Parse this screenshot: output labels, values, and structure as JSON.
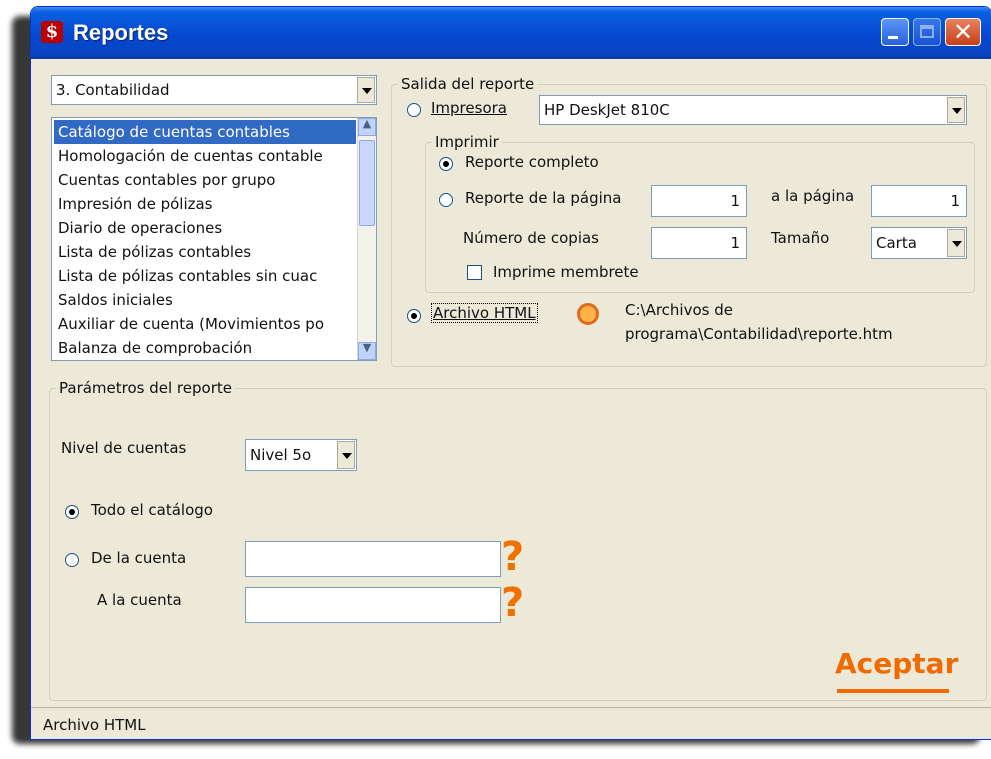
{
  "window": {
    "title": "Reportes",
    "app_icon": "S-logo-icon"
  },
  "module_select": {
    "value": "3. Contabilidad"
  },
  "report_list": {
    "items": [
      "Catálogo de cuentas contables",
      "Homologación de cuentas contable",
      "Cuentas contables por grupo",
      "Impresión de pólizas",
      "Diario de operaciones",
      "Lista de pólizas contables",
      "Lista de pólizas contables sin cuac",
      "Saldos iniciales",
      "Auxiliar de cuenta (Movimientos po",
      "Balanza de comprobación"
    ],
    "selected_index": 0
  },
  "output": {
    "legend": "Salida del reporte",
    "printer_radio": "Impresora",
    "printer_value": "HP DeskJet 810C",
    "print_group": {
      "legend": "Imprimir",
      "full_report": "Reporte completo",
      "page_report": "Reporte de la página",
      "from_page": "1",
      "to_page_label": "a la página",
      "to_page": "1",
      "copies_label": "Número de copias",
      "copies": "1",
      "size_label": "Tamaño",
      "size_value": "Carta",
      "letterhead": "Imprime membrete"
    },
    "html_radio": "Archivo HTML",
    "html_path_line1": "C:\\Archivos de",
    "html_path_line2": "programa\\Contabilidad\\reporte.htm"
  },
  "params": {
    "legend": "Parámetros del reporte",
    "level_label": "Nivel de cuentas",
    "level_value": "Nivel 5o",
    "all_catalog": "Todo el catálogo",
    "from_account": "De la cuenta",
    "to_account": "A la cuenta",
    "help_glyph": "?"
  },
  "accept_label": "Aceptar",
  "status": {
    "text": "Archivo HTML"
  }
}
